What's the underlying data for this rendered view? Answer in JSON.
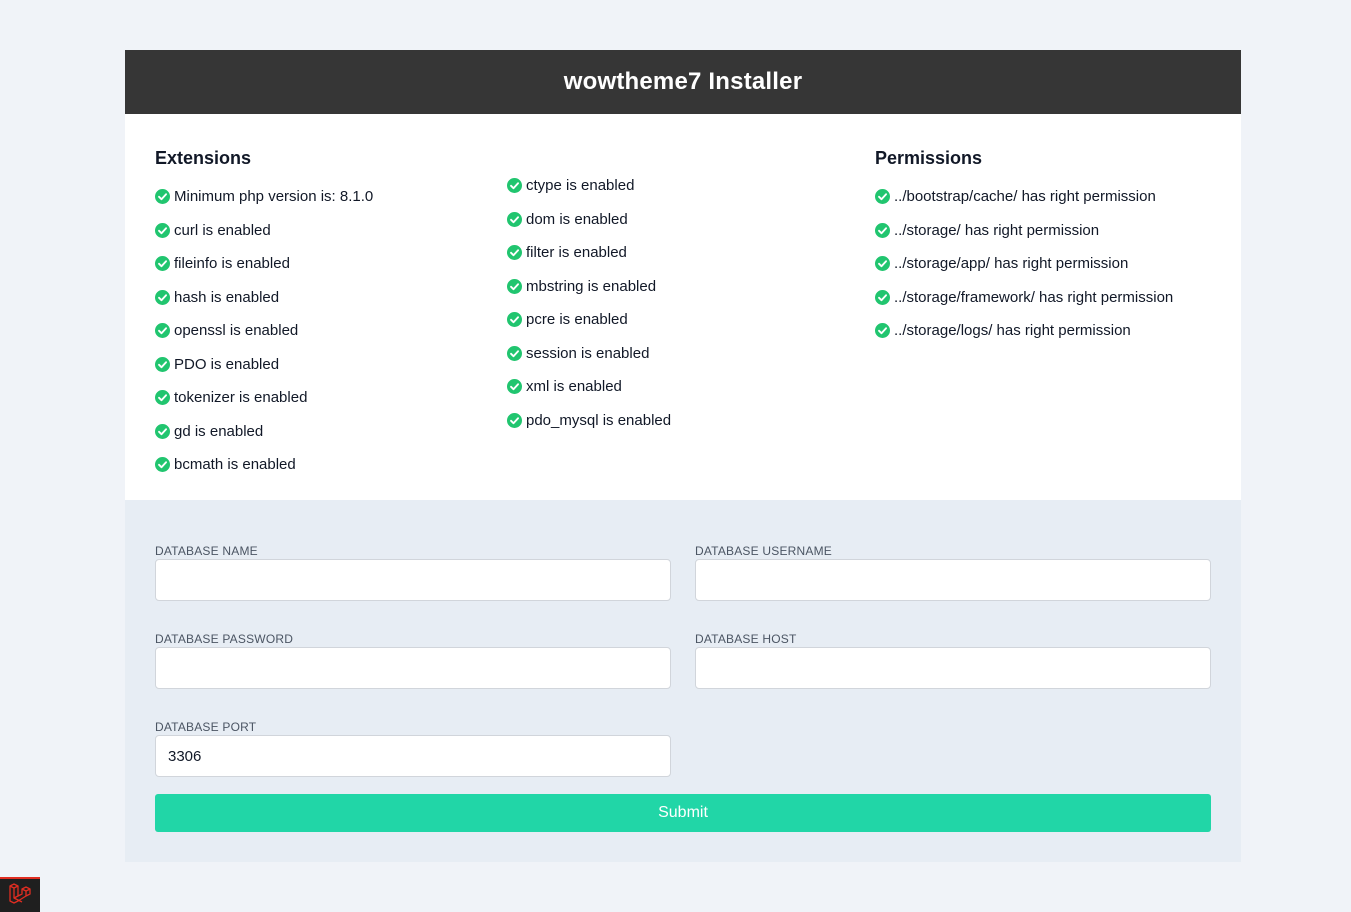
{
  "header": {
    "title": "wowtheme7 Installer"
  },
  "extensions": {
    "title": "Extensions",
    "col1": [
      "Minimum php version is: 8.1.0",
      "curl is enabled",
      "fileinfo is enabled",
      "hash is enabled",
      "openssl is enabled",
      "PDO is enabled",
      "tokenizer is enabled",
      "gd is enabled",
      "bcmath is enabled"
    ],
    "col2": [
      "ctype is enabled",
      "dom is enabled",
      "filter is enabled",
      "mbstring is enabled",
      "pcre is enabled",
      "session is enabled",
      "xml is enabled",
      "pdo_mysql is enabled"
    ]
  },
  "permissions": {
    "title": "Permissions",
    "items": [
      "../bootstrap/cache/ has right permission",
      "../storage/ has right permission",
      "../storage/app/ has right permission",
      "../storage/framework/ has right permission",
      "../storage/logs/ has right permission"
    ]
  },
  "form": {
    "db_name": {
      "label": "DATABASE NAME",
      "value": ""
    },
    "db_username": {
      "label": "DATABASE USERNAME",
      "value": ""
    },
    "db_password": {
      "label": "DATABASE PASSWORD",
      "value": ""
    },
    "db_host": {
      "label": "DATABASE HOST",
      "value": ""
    },
    "db_port": {
      "label": "DATABASE PORT",
      "value": "3306"
    },
    "submit_label": "Submit"
  },
  "colors": {
    "header_bg": "#363636",
    "check_green": "#21c56f",
    "submit_bg": "#21d6a7",
    "form_bg": "#e7edf4",
    "laravel_red": "#e02d21"
  },
  "icons": {
    "check": "check-circle-icon",
    "laravel": "laravel-logo-icon"
  }
}
